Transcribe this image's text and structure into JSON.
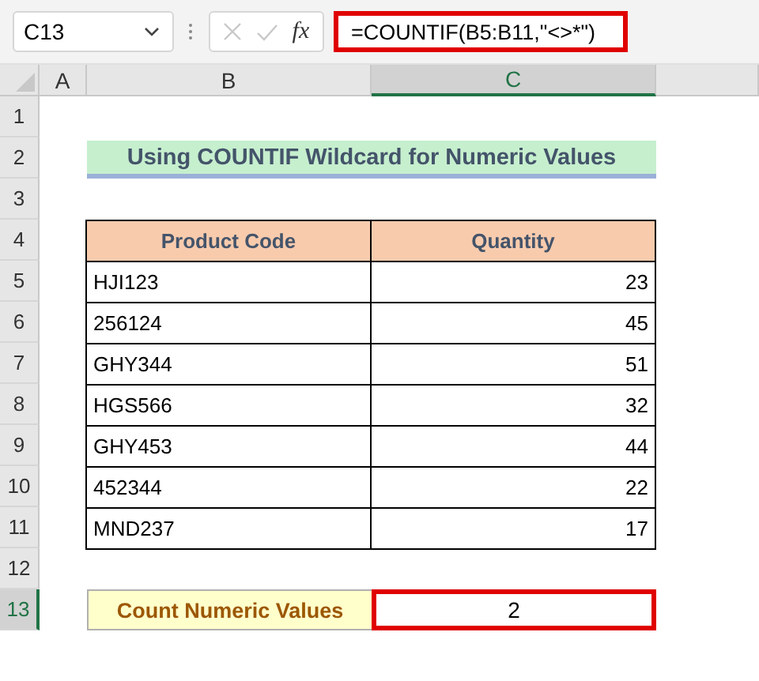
{
  "formula_bar": {
    "name_box": "C13",
    "fx_label": "fx",
    "formula": "=COUNTIF(B5:B11,\"<>*\")"
  },
  "columns": [
    {
      "label": "A",
      "selected": false
    },
    {
      "label": "B",
      "selected": false
    },
    {
      "label": "C",
      "selected": true
    }
  ],
  "rows": [
    {
      "number": "1",
      "selected": false,
      "kind": "empty"
    },
    {
      "number": "2",
      "selected": false,
      "kind": "title",
      "text": "Using COUNTIF Wildcard for Numeric Values"
    },
    {
      "number": "3",
      "selected": false,
      "kind": "empty"
    },
    {
      "number": "4",
      "selected": false,
      "kind": "header",
      "cells": [
        "Product Code",
        "Quantity"
      ]
    },
    {
      "number": "5",
      "selected": false,
      "kind": "data",
      "cells": [
        "HJI123",
        "23"
      ]
    },
    {
      "number": "6",
      "selected": false,
      "kind": "data",
      "cells": [
        "256124",
        "45"
      ]
    },
    {
      "number": "7",
      "selected": false,
      "kind": "data",
      "cells": [
        "GHY344",
        "51"
      ]
    },
    {
      "number": "8",
      "selected": false,
      "kind": "data",
      "cells": [
        "HGS566",
        "32"
      ]
    },
    {
      "number": "9",
      "selected": false,
      "kind": "data",
      "cells": [
        "GHY453",
        "44"
      ]
    },
    {
      "number": "10",
      "selected": false,
      "kind": "data",
      "cells": [
        "452344",
        "22"
      ]
    },
    {
      "number": "11",
      "selected": false,
      "kind": "data",
      "cells": [
        "MND237",
        "17"
      ]
    },
    {
      "number": "12",
      "selected": false,
      "kind": "empty"
    },
    {
      "number": "13",
      "selected": true,
      "kind": "summary",
      "cells": [
        "Count Numeric Values",
        "2"
      ],
      "active_cell_selected": true
    }
  ]
}
